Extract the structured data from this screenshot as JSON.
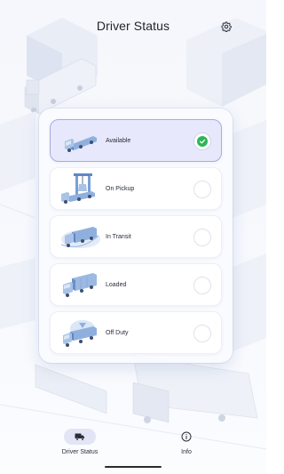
{
  "header": {
    "title": "Driver Status",
    "settings_icon": "gear-icon"
  },
  "status_options": [
    {
      "label": "Available",
      "icon": "flatbed-truck-icon",
      "selected": true
    },
    {
      "label": "On Pickup",
      "icon": "crane-loading-truck-icon",
      "selected": false
    },
    {
      "label": "In Transit",
      "icon": "moving-truck-icon",
      "selected": false
    },
    {
      "label": "Loaded",
      "icon": "container-truck-icon",
      "selected": false
    },
    {
      "label": "Off Duty",
      "icon": "parked-truck-icon",
      "selected": false
    }
  ],
  "bottom_nav": [
    {
      "label": "Driver Status",
      "icon": "truck-icon",
      "active": true
    },
    {
      "label": "Info",
      "icon": "info-icon",
      "active": false
    }
  ],
  "colors": {
    "selected_bg": "#e7e8fb",
    "selected_border": "#a9acde",
    "check_green": "#2fb556",
    "nav_active_pill": "#e3e5f6"
  }
}
